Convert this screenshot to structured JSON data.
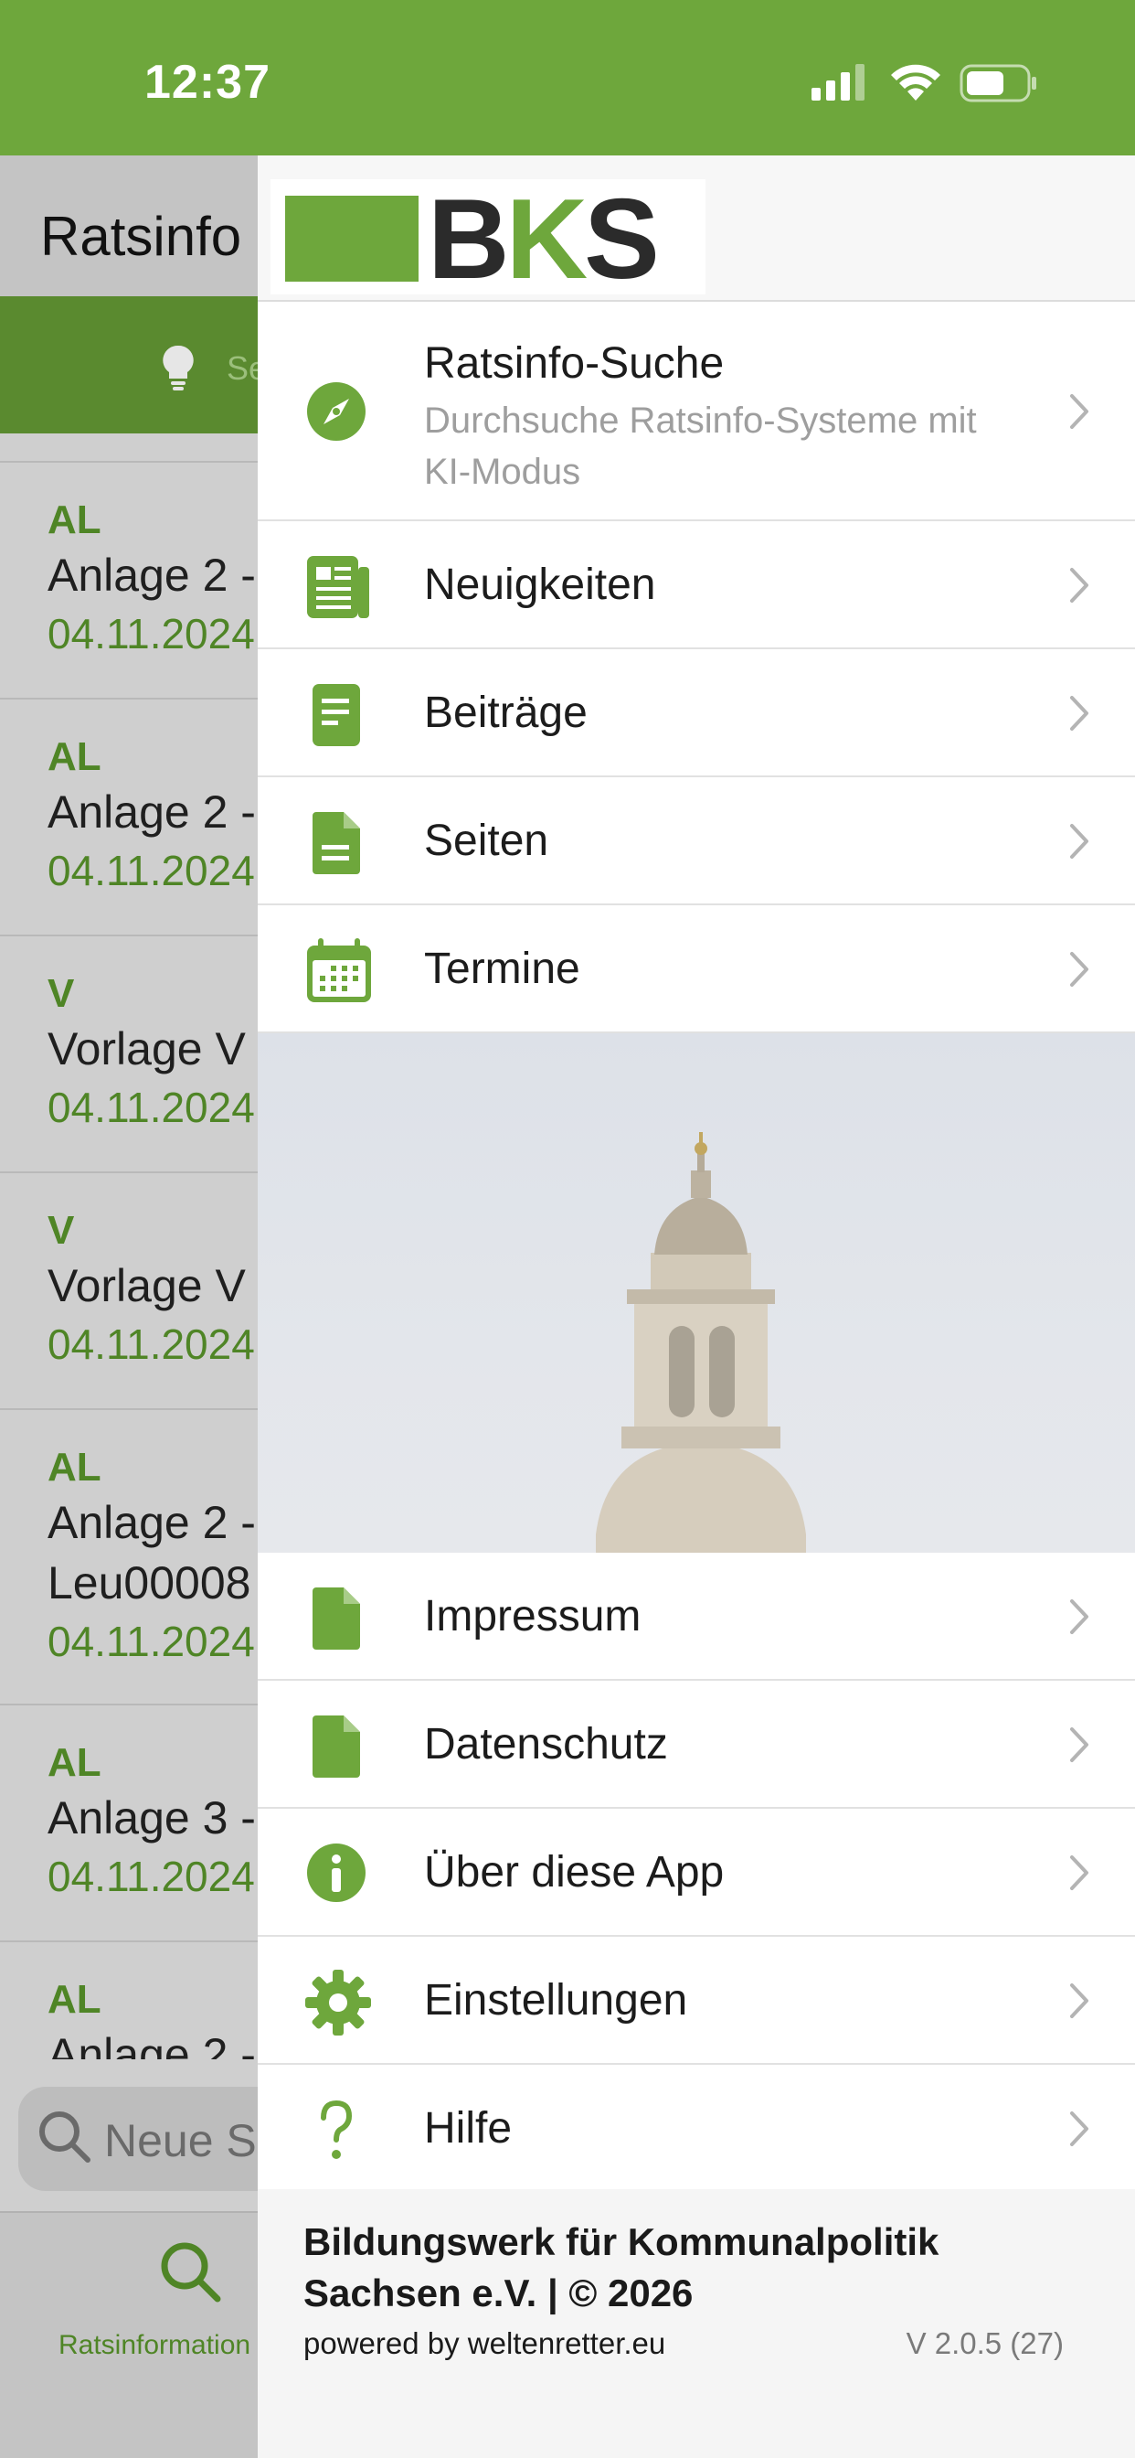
{
  "status_bar": {
    "time": "12:37"
  },
  "background_screen": {
    "title": "Ratsinfo",
    "search_hint": "Se",
    "items": [
      {
        "code": "AL",
        "name": "Anlage 2 -",
        "date": "04.11.2024"
      },
      {
        "code": "AL",
        "name": "Anlage 2 -",
        "date": "04.11.2024"
      },
      {
        "code": "V",
        "name": "Vorlage V",
        "date": "04.11.2024"
      },
      {
        "code": "V",
        "name": "Vorlage V",
        "date": "04.11.2024"
      },
      {
        "code": "AL",
        "name": "Anlage 2 -",
        "name2": "Leu00008",
        "date": "04.11.2024"
      },
      {
        "code": "AL",
        "name": "Anlage 3 -",
        "date": "04.11.2024"
      },
      {
        "code": "AL",
        "name": "Anlage 2 -",
        "date": ""
      }
    ],
    "search_placeholder": "Neue S",
    "tab_label": "Ratsinformation"
  },
  "drawer": {
    "logo_text_b": "B",
    "logo_text_k": "K",
    "logo_text_s": "S",
    "menu_top": [
      {
        "label": "Ratsinfo-Suche",
        "sub": "Durchsuche Ratsinfo-Systeme mit KI-Modus",
        "icon": "compass-icon"
      },
      {
        "label": "Neuigkeiten",
        "icon": "newspaper-icon"
      },
      {
        "label": "Beiträge",
        "icon": "document-icon"
      },
      {
        "label": "Seiten",
        "icon": "page-icon"
      },
      {
        "label": "Termine",
        "icon": "calendar-icon"
      }
    ],
    "menu_bottom": [
      {
        "label": "Impressum",
        "icon": "file-icon"
      },
      {
        "label": "Datenschutz",
        "icon": "file-icon"
      },
      {
        "label": "Über diese App",
        "icon": "info-icon"
      },
      {
        "label": "Einstellungen",
        "icon": "gear-icon"
      },
      {
        "label": "Hilfe",
        "icon": "question-icon"
      }
    ],
    "footer": {
      "org": "Bildungswerk für Kommunalpolitik Sachsen e.V. | © 2026",
      "powered": "powered by weltenretter.eu",
      "version": "V 2.0.5 (27)"
    }
  },
  "colors": {
    "accent": "#6ea73c",
    "accent_dark": "#4f8526"
  }
}
